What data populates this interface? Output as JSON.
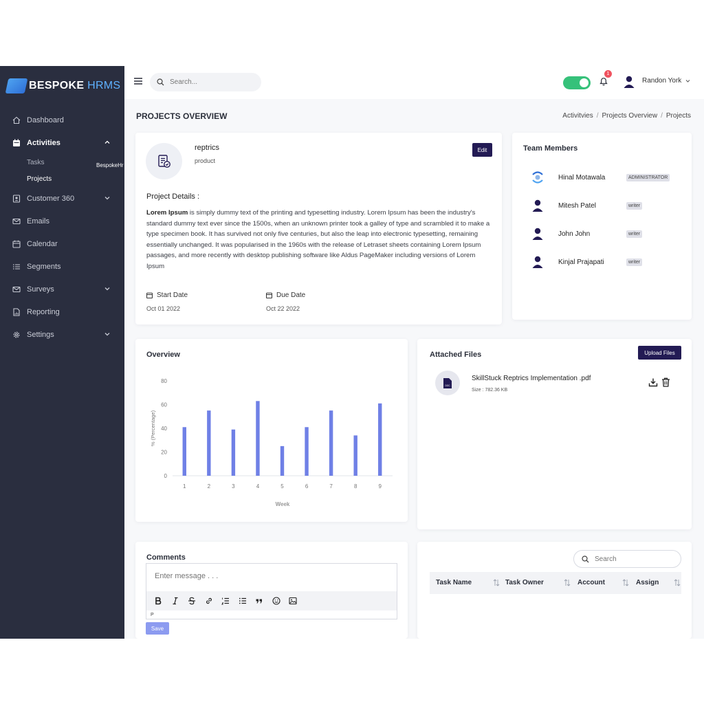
{
  "brand": {
    "name_bold": "BESPOKE",
    "name_light": " HRMS"
  },
  "sidebar": {
    "items": [
      {
        "label": "Dashboard",
        "icon": "home-icon"
      },
      {
        "label": "Activities",
        "icon": "calendar-icon",
        "active": true
      },
      {
        "label": "Customer 360",
        "icon": "contacts-icon"
      },
      {
        "label": "Emails",
        "icon": "mail-icon"
      },
      {
        "label": "Calendar",
        "icon": "calendar-outline-icon"
      },
      {
        "label": "Segments",
        "icon": "list-icon"
      },
      {
        "label": "Surveys",
        "icon": "inbox-icon"
      },
      {
        "label": "Reporting",
        "icon": "report-icon"
      },
      {
        "label": "Settings",
        "icon": "gear-icon"
      }
    ],
    "sub_items": [
      {
        "label": "Tasks"
      },
      {
        "label": "Projects"
      }
    ],
    "tooltip": "BespokeHr"
  },
  "header": {
    "search_placeholder": "Search...",
    "notification_count": "1",
    "user_name": "Randon York",
    "toggle_on": true
  },
  "page": {
    "title": "PROJECTS OVERVIEW",
    "breadcrumb": [
      "Activitvies",
      "Projects Overview",
      "Projects"
    ]
  },
  "project": {
    "name": "reptrics",
    "type": "product",
    "edit_label": "Edit",
    "details_title": "Project Details :",
    "details_bold": "Lorem Ipsum",
    "details_text": " is simply dummy text of the printing and typesetting industry. Lorem Ipsum has been the industry's standard dummy text ever since the 1500s, when an unknown printer took a galley of type and scrambled it to make a type specimen book. It has survived not only five centuries, but also the leap into electronic typesetting, remaining essentially unchanged. It was popularised in the 1960s with the release of Letraset sheets containing Lorem Ipsum passages, and more recently with desktop publishing software like Aldus PageMaker including versions of Lorem Ipsum",
    "start_label": "Start Date",
    "start_date": "Oct 01 2022",
    "due_label": "Due Date",
    "due_date": "Oct 22 2022"
  },
  "team": {
    "title": "Team Members",
    "members": [
      {
        "name": "Hinal Motawala",
        "role": "ADMINISTRATOR"
      },
      {
        "name": "Mitesh Patel",
        "role": "writer"
      },
      {
        "name": "John John",
        "role": "writer"
      },
      {
        "name": "Kinjal Prajapati",
        "role": "writer"
      }
    ]
  },
  "overview": {
    "title": "Overview"
  },
  "chart_data": {
    "type": "bar",
    "categories": [
      "1",
      "2",
      "3",
      "4",
      "5",
      "6",
      "7",
      "8",
      "9"
    ],
    "values": [
      41,
      55,
      39,
      63,
      25,
      41,
      55,
      34,
      61
    ],
    "xlabel": "Week",
    "ylabel": "% (Percentage)",
    "ylim": [
      0,
      80
    ],
    "yticks": [
      0,
      20,
      40,
      60,
      80
    ],
    "color": "#6f80e6",
    "grid": false
  },
  "files": {
    "title": "Attached Files",
    "upload_label": "Upload Files",
    "items": [
      {
        "name": "SkillStuck Reptrics Implementation .pdf",
        "size": "Size : 782.36 KB",
        "icon_text": "DOC"
      }
    ]
  },
  "comments": {
    "title": "Comments",
    "placeholder": "Enter message . . .",
    "p_tag": "P",
    "save_label": "Save"
  },
  "tasks": {
    "search_placeholder": "Search",
    "columns": [
      "Task Name",
      "Task Owner",
      "Account",
      "Assign"
    ]
  },
  "colors": {
    "sidebar": "#2a2e3f",
    "primary_button": "#231b54",
    "toggle": "#36c17a",
    "badge": "#f0525f",
    "bar": "#6f80e6"
  }
}
